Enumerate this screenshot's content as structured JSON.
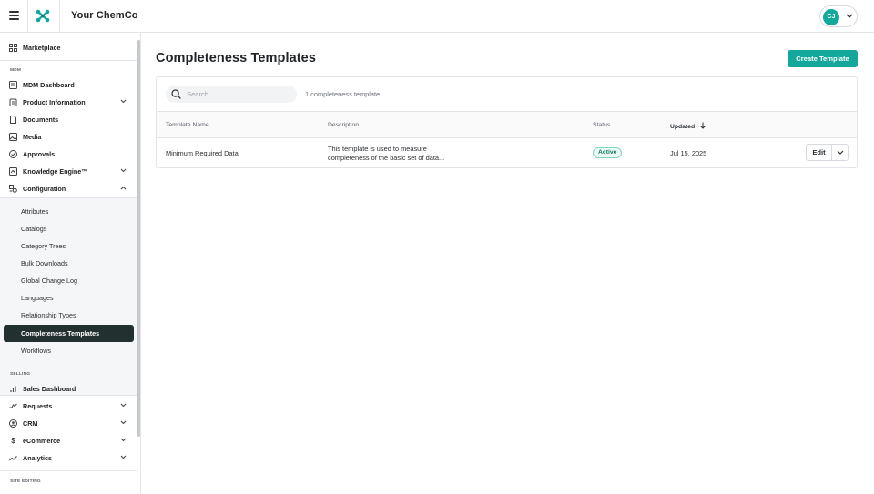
{
  "header": {
    "company_name": "Your ChemCo",
    "user_initials": "CJ",
    "accent_color": "#13a89b"
  },
  "sidebar": {
    "top_items": [
      {
        "label": "Marketplace",
        "icon": "grid-icon"
      }
    ],
    "sections": [
      {
        "label": "MDM"
      },
      {
        "label": "SELLING"
      },
      {
        "label": "SITE EDITING"
      }
    ],
    "mdm_items": [
      {
        "label": "MDM Dashboard",
        "icon": "dashboard-icon"
      },
      {
        "label": "Product Information",
        "icon": "clipboard-icon",
        "expandable": true
      },
      {
        "label": "Documents",
        "icon": "document-icon"
      },
      {
        "label": "Media",
        "icon": "image-icon"
      },
      {
        "label": "Approvals",
        "icon": "check-circle-icon"
      },
      {
        "label": "Knowledge Engine™",
        "icon": "engine-icon",
        "expandable": true
      },
      {
        "label": "Configuration",
        "icon": "settings-icon",
        "expanded": true
      }
    ],
    "configuration_items": [
      {
        "label": "Attributes"
      },
      {
        "label": "Catalogs"
      },
      {
        "label": "Category Trees"
      },
      {
        "label": "Bulk Downloads"
      },
      {
        "label": "Global Change Log"
      },
      {
        "label": "Languages"
      },
      {
        "label": "Relationship Types"
      },
      {
        "label": "Completeness Templates",
        "active": true
      },
      {
        "label": "Workflows"
      }
    ],
    "selling_items": [
      {
        "label": "Sales Dashboard",
        "icon": "bar-chart-icon"
      },
      {
        "label": "Requests",
        "icon": "requests-icon",
        "expandable": true
      },
      {
        "label": "CRM",
        "icon": "user-circle-icon",
        "expandable": true
      },
      {
        "label": "eCommerce",
        "icon": "dollar-icon",
        "expandable": true
      },
      {
        "label": "Analytics",
        "icon": "trend-icon",
        "expandable": true
      }
    ]
  },
  "main": {
    "title": "Completeness Templates",
    "create_button": "Create Template",
    "search_placeholder": "Search",
    "count_text": "1 completeness template",
    "columns": [
      "Template Name",
      "Description",
      "Status",
      "Updated"
    ],
    "sort_column": "Updated",
    "sort_direction": "descending",
    "rows": [
      {
        "name": "Minimum Required Data",
        "description_line1": "This template is used to measure",
        "description_line2": "completeness of the basic set of data...",
        "status": "Active",
        "updated": "Jul 15, 2025",
        "action": "Edit"
      }
    ]
  }
}
